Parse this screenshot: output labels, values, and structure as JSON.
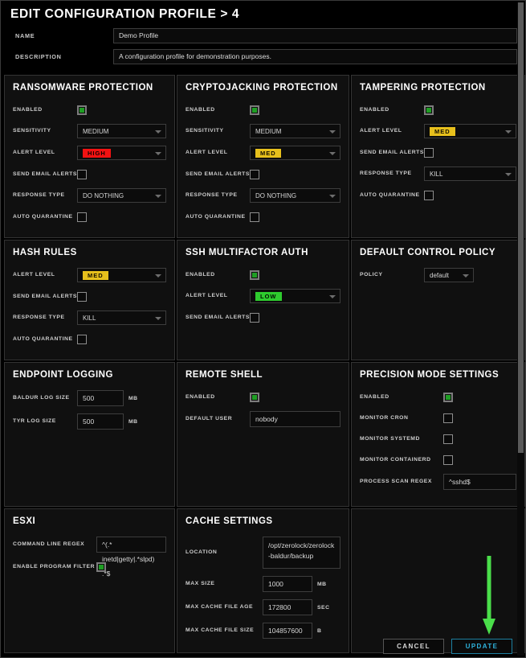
{
  "header": {
    "title": "EDIT CONFIGURATION PROFILE > 4"
  },
  "meta": {
    "name_label": "NAME",
    "name_value": "Demo Profile",
    "description_label": "DESCRIPTION",
    "description_value": "A configuration profile for demonstration purposes."
  },
  "colors": {
    "badge_high": "#f21212",
    "badge_med": "#e7c01c",
    "badge_low": "#2ecb2e",
    "enabled_green": "#1f9e24",
    "update_accent": "#2fb3dd",
    "annotation_arrow": "#4ade4a"
  },
  "panels": {
    "ransomware": {
      "title": "RANSOMWARE PROTECTION",
      "enabled_label": "ENABLED",
      "enabled_value": "checked",
      "sensitivity_label": "SENSITIVITY",
      "sensitivity_value": "MEDIUM",
      "alert_level_label": "ALERT LEVEL",
      "alert_level_value": "HIGH",
      "send_email_label": "SEND EMAIL ALERTS",
      "send_email_value": "unchecked",
      "response_type_label": "RESPONSE TYPE",
      "response_type_value": "DO NOTHING",
      "auto_quarantine_label": "AUTO QUARANTINE",
      "auto_quarantine_value": "unchecked"
    },
    "cryptojacking": {
      "title": "CRYPTOJACKING PROTECTION",
      "enabled_label": "ENABLED",
      "enabled_value": "checked",
      "sensitivity_label": "SENSITIVITY",
      "sensitivity_value": "MEDIUM",
      "alert_level_label": "ALERT LEVEL",
      "alert_level_value": "MED",
      "send_email_label": "SEND EMAIL ALERTS",
      "send_email_value": "unchecked",
      "response_type_label": "RESPONSE TYPE",
      "response_type_value": "DO NOTHING",
      "auto_quarantine_label": "AUTO QUARANTINE",
      "auto_quarantine_value": "unchecked"
    },
    "tampering": {
      "title": "TAMPERING PROTECTION",
      "enabled_label": "ENABLED",
      "enabled_value": "checked",
      "alert_level_label": "ALERT LEVEL",
      "alert_level_value": "MED",
      "send_email_label": "SEND EMAIL ALERTS",
      "send_email_value": "unchecked",
      "response_type_label": "RESPONSE TYPE",
      "response_type_value": "KILL",
      "auto_quarantine_label": "AUTO QUARANTINE",
      "auto_quarantine_value": "unchecked"
    },
    "hash_rules": {
      "title": "HASH RULES",
      "alert_level_label": "ALERT LEVEL",
      "alert_level_value": "MED",
      "send_email_label": "SEND EMAIL ALERTS",
      "send_email_value": "unchecked",
      "response_type_label": "RESPONSE TYPE",
      "response_type_value": "KILL",
      "auto_quarantine_label": "AUTO QUARANTINE",
      "auto_quarantine_value": "unchecked"
    },
    "ssh_mfa": {
      "title": "SSH MULTIFACTOR AUTH",
      "enabled_label": "ENABLED",
      "enabled_value": "checked",
      "alert_level_label": "ALERT LEVEL",
      "alert_level_value": "LOW",
      "send_email_label": "SEND EMAIL ALERTS",
      "send_email_value": "unchecked"
    },
    "default_control_policy": {
      "title": "DEFAULT CONTROL POLICY",
      "policy_label": "POLICY",
      "policy_value": "default"
    },
    "endpoint_logging": {
      "title": "ENDPOINT LOGGING",
      "baldur_label": "BALDUR LOG SIZE",
      "baldur_value": "500",
      "baldur_unit": "MB",
      "tyr_label": "TYR LOG SIZE",
      "tyr_value": "500",
      "tyr_unit": "MB"
    },
    "remote_shell": {
      "title": "REMOTE SHELL",
      "enabled_label": "ENABLED",
      "enabled_value": "checked",
      "default_user_label": "DEFAULT USER",
      "default_user_value": "nobody"
    },
    "precision_mode": {
      "title": "PRECISION MODE SETTINGS",
      "enabled_label": "ENABLED",
      "enabled_value": "checked",
      "monitor_cron_label": "MONITOR CRON",
      "monitor_cron_value": "unchecked",
      "monitor_systemd_label": "MONITOR SYSTEMD",
      "monitor_systemd_value": "unchecked",
      "monitor_containerd_label": "MONITOR CONTAINERD",
      "monitor_containerd_value": "unchecked",
      "process_scan_regex_label": "PROCESS SCAN REGEX",
      "process_scan_regex_value": "^sshd$"
    },
    "esxi": {
      "title": "ESXI",
      "command_line_regex_label": "COMMAND LINE REGEX",
      "command_line_regex_value": "^(.* inetd|getty|.*slpd) .*$",
      "enable_program_filter_label": "ENABLE PROGRAM FILTER",
      "enable_program_filter_value": "checked"
    },
    "cache_settings": {
      "title": "CACHE SETTINGS",
      "location_label": "LOCATION",
      "location_value": "/opt/zerolock/zerolock-baldur/backup",
      "max_size_label": "MAX SIZE",
      "max_size_value": "1000",
      "max_size_unit": "MB",
      "max_cache_file_age_label": "MAX CACHE FILE AGE",
      "max_cache_file_age_value": "172800",
      "max_cache_file_age_unit": "SEC",
      "max_cache_file_size_label": "MAX CACHE FILE SIZE",
      "max_cache_file_size_value": "104857600",
      "max_cache_file_size_unit": "B"
    }
  },
  "footer": {
    "cancel_label": "CANCEL",
    "update_label": "UPDATE"
  }
}
